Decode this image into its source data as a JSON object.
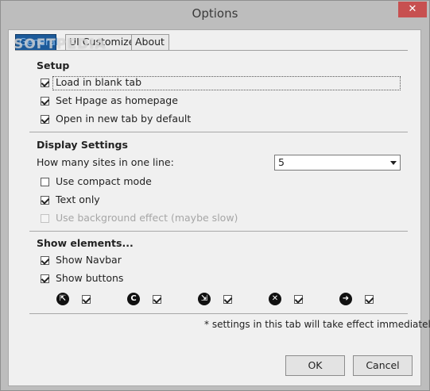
{
  "window": {
    "title": "Options",
    "close_glyph": "✕"
  },
  "watermark": "SOFTPEDIA",
  "tabs": [
    {
      "label": "General",
      "active": true
    },
    {
      "label": "UI Customize",
      "active": false
    },
    {
      "label": "About",
      "active": false
    }
  ],
  "setup": {
    "heading": "Setup",
    "items": [
      {
        "label": "Load in blank tab",
        "checked": true
      },
      {
        "label": "Set Hpage as homepage",
        "checked": true
      },
      {
        "label": "Open in new tab by default",
        "checked": true
      }
    ]
  },
  "display": {
    "heading": "Display Settings",
    "sites_label": "How many sites in one line:",
    "sites_value": "5",
    "items": [
      {
        "label": "Use compact mode",
        "checked": false,
        "disabled": false
      },
      {
        "label": "Text only",
        "checked": true,
        "disabled": false
      },
      {
        "label": "Use background effect (maybe slow)",
        "checked": false,
        "disabled": true
      }
    ]
  },
  "elements": {
    "heading": "Show elements...",
    "items": [
      {
        "label": "Show Navbar",
        "checked": true
      },
      {
        "label": "Show buttons",
        "checked": true
      }
    ],
    "buttons": [
      {
        "icon": "open-tab-icon",
        "checked": true
      },
      {
        "icon": "refresh-icon",
        "checked": true
      },
      {
        "icon": "share-icon",
        "checked": true
      },
      {
        "icon": "close-icon",
        "checked": true
      },
      {
        "icon": "forward-arrow-icon",
        "checked": true
      }
    ],
    "glyphs": [
      "⇱",
      "C",
      "⇲",
      "✕",
      "➜"
    ]
  },
  "note": "* settings in this tab will take effect immediately",
  "footer": {
    "ok_label": "OK",
    "cancel_label": "Cancel"
  }
}
